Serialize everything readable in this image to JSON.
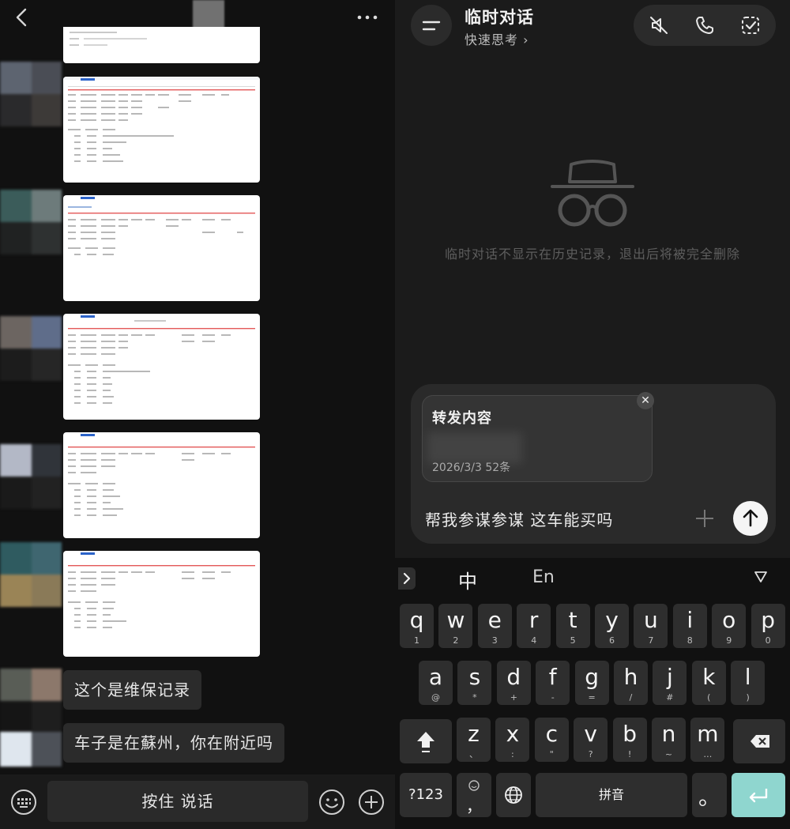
{
  "left_chat": {
    "messages": [
      {
        "type": "text",
        "text": "这个是维保记录"
      },
      {
        "type": "text",
        "text": "车子是在蘇州，你在附近吗"
      }
    ],
    "bottom_bar": {
      "hold_to_talk_label": "按住 说话"
    }
  },
  "assistant": {
    "title": "临时对话",
    "subtitle": "快速思考 ›",
    "privacy_note": "临时对话不显示在历史记录，退出后将被完全删除",
    "forward_card": {
      "title": "转发内容",
      "meta": "2026/3/3   52条"
    },
    "input_text": "帮我参谋参谋 这车能买吗"
  },
  "keyboard": {
    "lang_cn": "中",
    "lang_en": "En",
    "row1": [
      {
        "k": "q",
        "s": "1"
      },
      {
        "k": "w",
        "s": "2"
      },
      {
        "k": "e",
        "s": "3"
      },
      {
        "k": "r",
        "s": "4"
      },
      {
        "k": "t",
        "s": "5"
      },
      {
        "k": "y",
        "s": "6"
      },
      {
        "k": "u",
        "s": "7"
      },
      {
        "k": "i",
        "s": "8"
      },
      {
        "k": "o",
        "s": "9"
      },
      {
        "k": "p",
        "s": "0"
      }
    ],
    "row2": [
      {
        "k": "a",
        "s": "@"
      },
      {
        "k": "s",
        "s": "*"
      },
      {
        "k": "d",
        "s": "+"
      },
      {
        "k": "f",
        "s": "-"
      },
      {
        "k": "g",
        "s": "="
      },
      {
        "k": "h",
        "s": "/"
      },
      {
        "k": "j",
        "s": "#"
      },
      {
        "k": "k",
        "s": "("
      },
      {
        "k": "l",
        "s": ")"
      }
    ],
    "row3": [
      {
        "k": "z",
        "s": "、"
      },
      {
        "k": "x",
        "s": ":"
      },
      {
        "k": "c",
        "s": "\""
      },
      {
        "k": "v",
        "s": "?"
      },
      {
        "k": "b",
        "s": "!"
      },
      {
        "k": "n",
        "s": "~"
      },
      {
        "k": "m",
        "s": "…"
      }
    ],
    "num_key": "?123",
    "comma_key": "，",
    "space_label": "拼音",
    "period_key": "。"
  },
  "colors": {
    "enter_key": "#8fd6cf",
    "bubble": "#2b2b2b",
    "left_bg": "#111111",
    "right_bg": "#1b1b1b"
  }
}
